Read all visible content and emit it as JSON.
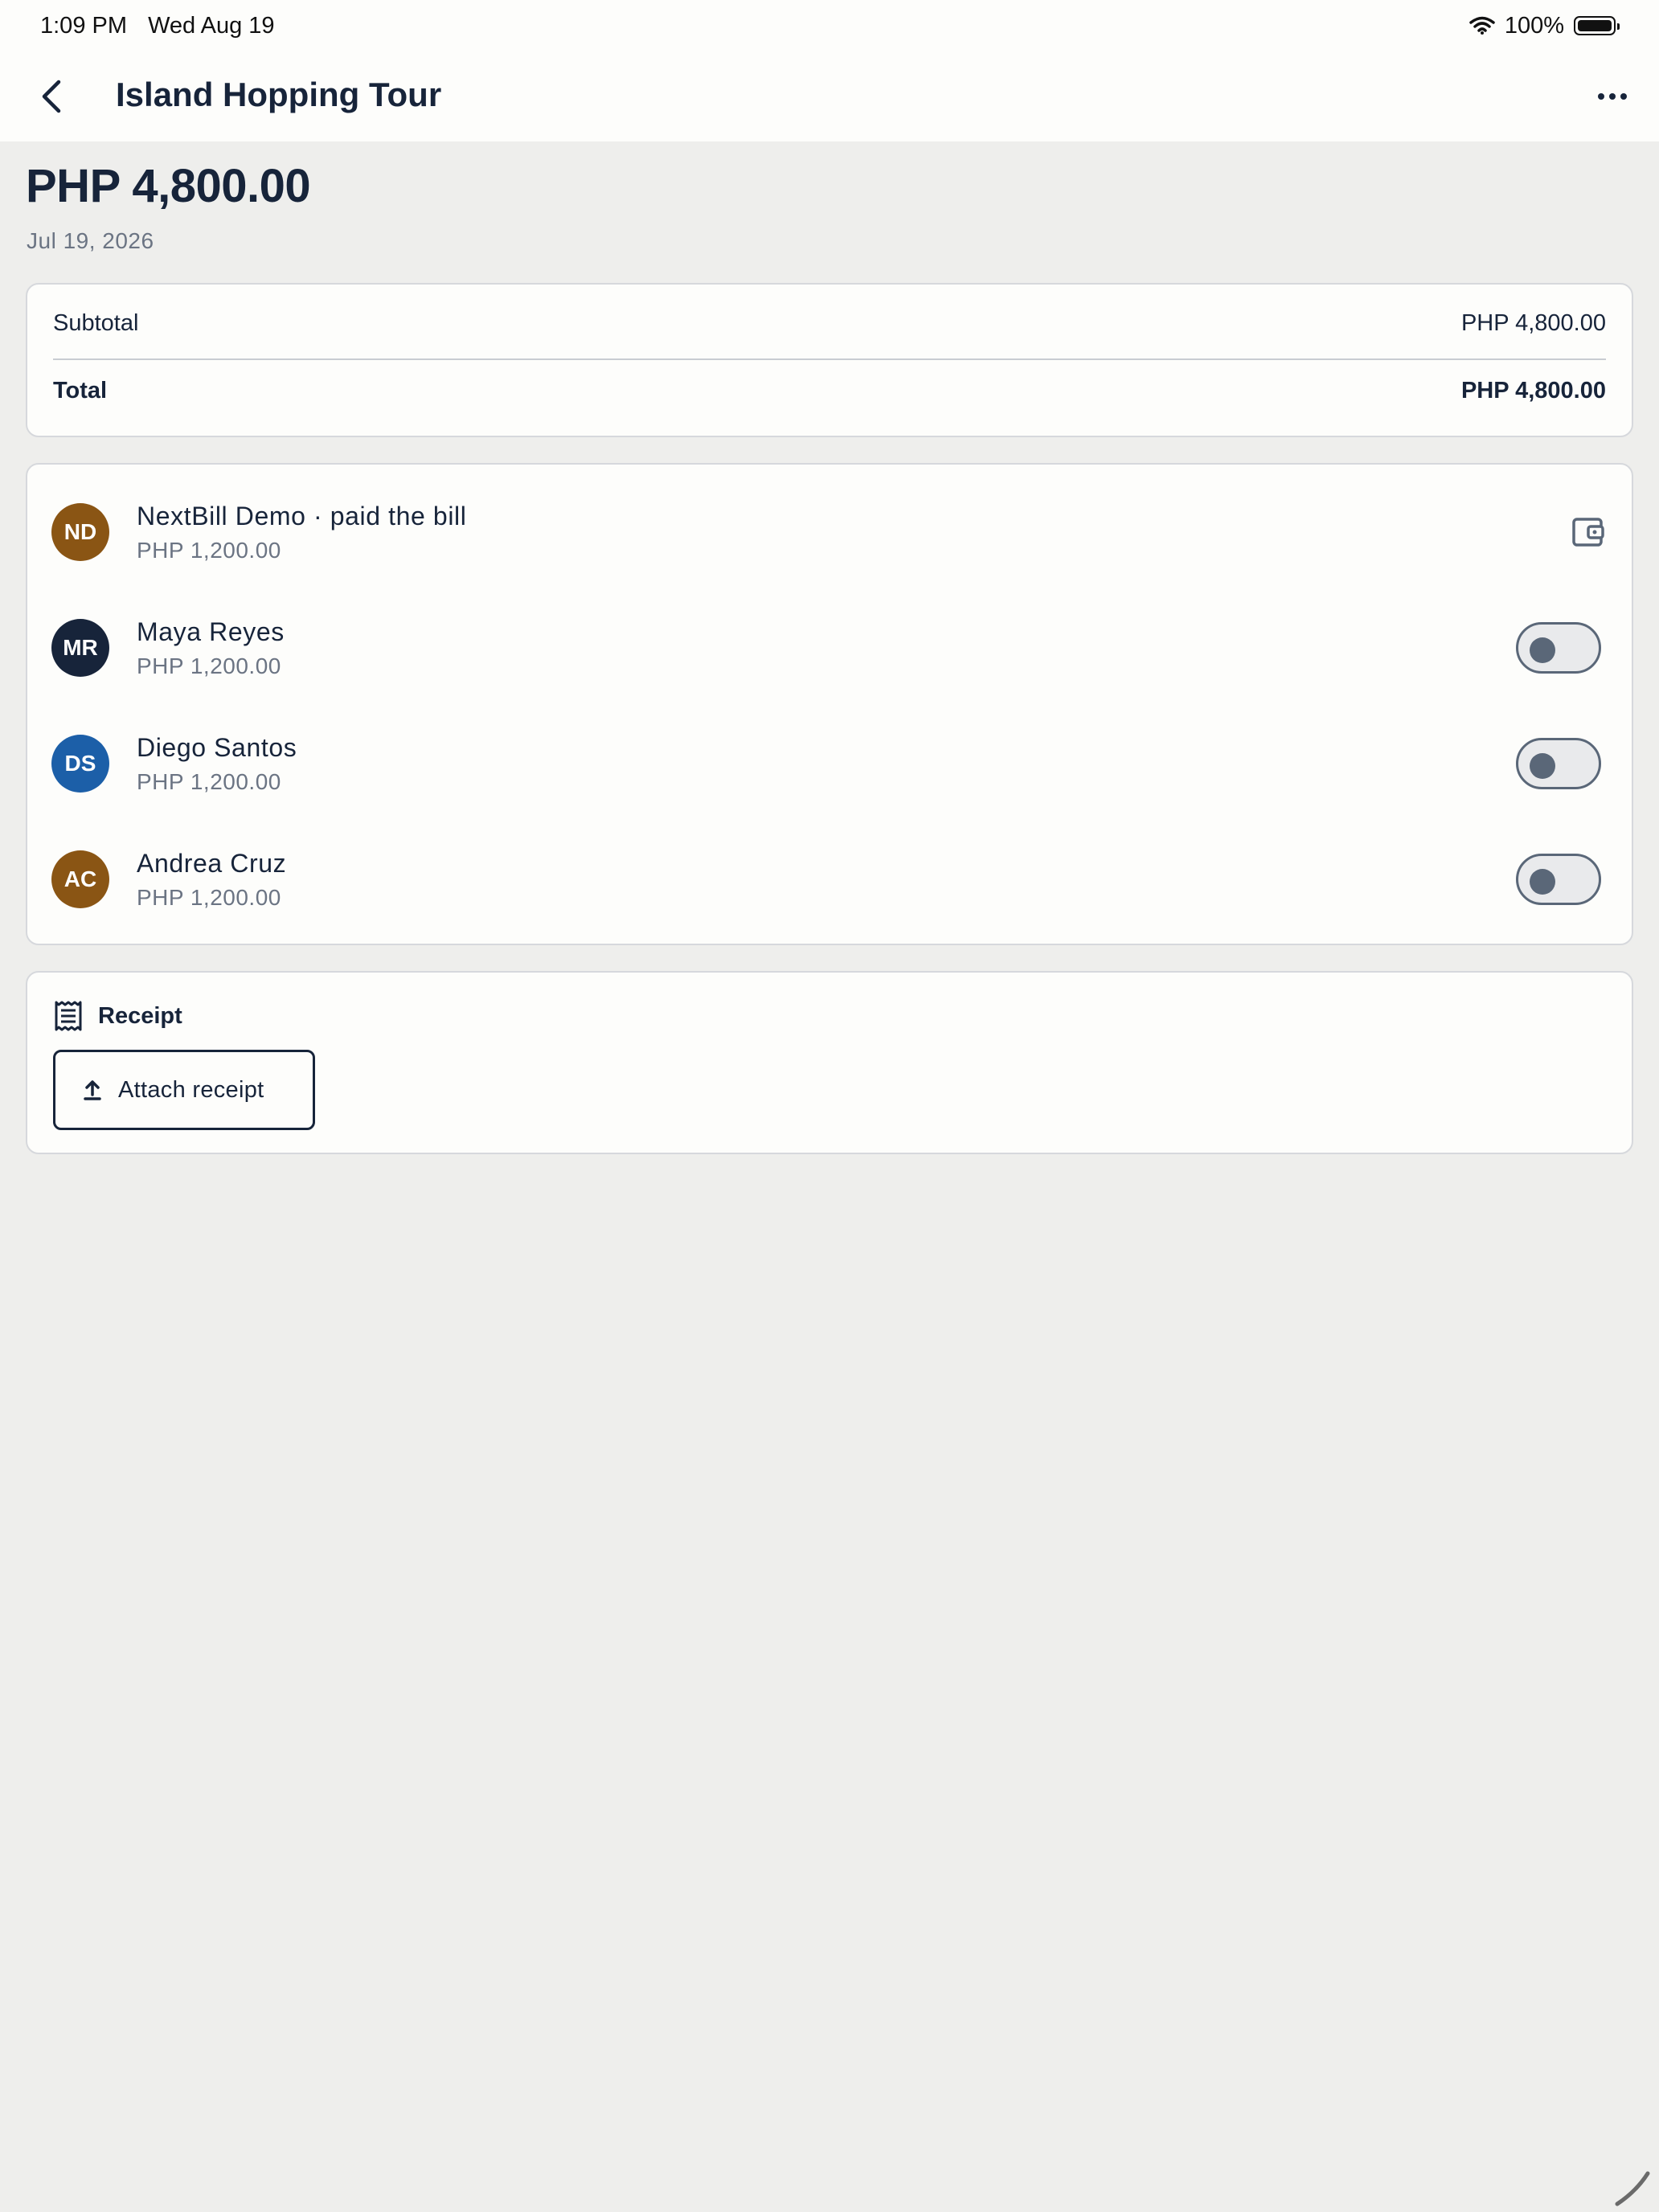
{
  "status_bar": {
    "time": "1:09 PM",
    "date": "Wed Aug 19",
    "battery": "100%",
    "icons": [
      "wifi-icon",
      "battery-icon"
    ]
  },
  "nav": {
    "title": "Island Hopping Tour",
    "back_icon": "chevron-left-icon",
    "more_icon": "ellipsis-icon"
  },
  "summary": {
    "amount": "PHP 4,800.00",
    "date": "Jul 19, 2026"
  },
  "totals": {
    "subtotal_label": "Subtotal",
    "subtotal_value": "PHP 4,800.00",
    "total_label": "Total",
    "total_value": "PHP 4,800.00"
  },
  "people": [
    {
      "initials": "ND",
      "name": "NextBill Demo · paid the bill",
      "amount": "PHP 1,200.00",
      "color": "#8a5514",
      "control": "wallet-icon"
    },
    {
      "initials": "MR",
      "name": "Maya Reyes",
      "amount": "PHP 1,200.00",
      "color": "#17243a",
      "control": "toggle",
      "settled": false
    },
    {
      "initials": "DS",
      "name": "Diego Santos",
      "amount": "PHP 1,200.00",
      "color": "#1c5fa8",
      "control": "toggle",
      "settled": false
    },
    {
      "initials": "AC",
      "name": "Andrea Cruz",
      "amount": "PHP 1,200.00",
      "color": "#8a5514",
      "control": "toggle",
      "settled": false
    }
  ],
  "receipt": {
    "title": "Receipt",
    "attach_label": "Attach receipt",
    "icon": "receipt-icon",
    "attach_icon": "upload-icon"
  },
  "colors": {
    "background": "#eeeeec",
    "surface": "#fdfdfb",
    "text_primary": "#17243a",
    "text_secondary": "#6b7483"
  }
}
